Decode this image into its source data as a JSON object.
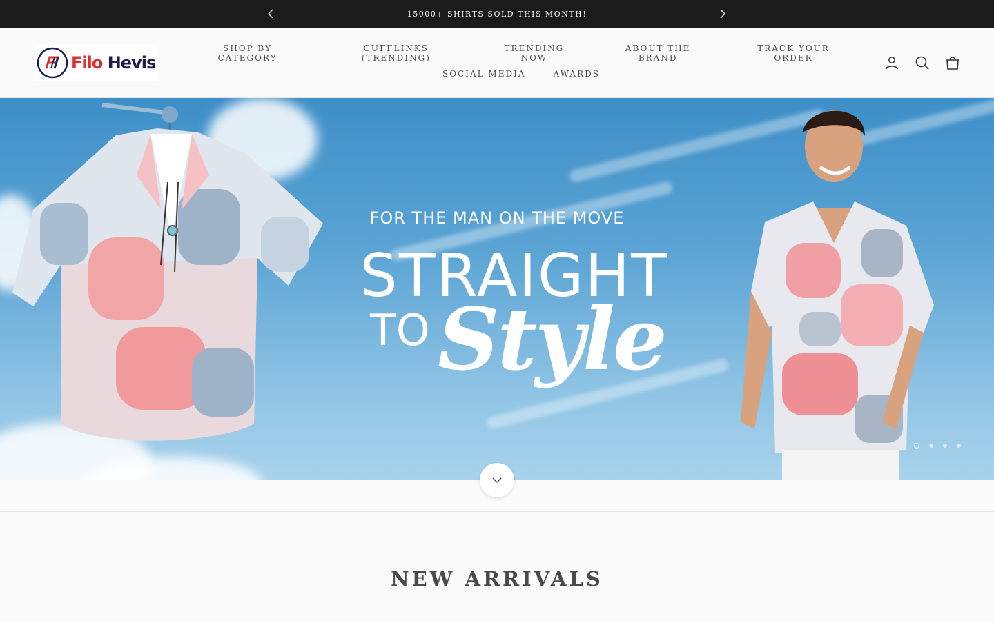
{
  "announcement": {
    "message": "15000+ SHIRTS SOLD THIS MONTH!",
    "prev_icon": "chevron-left-icon",
    "next_icon": "chevron-right-icon"
  },
  "header": {
    "logo": {
      "filo": "Filo",
      "hevis": "Hevis",
      "brand_colors": {
        "red": "#e32b2b",
        "navy": "#1c1d4e"
      }
    },
    "nav_row1": [
      "SHOP BY CATEGORY",
      "CUFFLINKS (TRENDING)",
      "TRENDING NOW",
      "ABOUT THE BRAND",
      "TRACK YOUR ORDER"
    ],
    "nav_row2": [
      "SOCIAL MEDIA",
      "AWARDS"
    ],
    "icons": [
      "account-icon",
      "search-icon",
      "cart-icon"
    ]
  },
  "hero": {
    "tagline": "FOR THE MAN ON THE MOVE",
    "headline_line1": "STRAIGHT",
    "headline_to": "TO",
    "headline_style": "Style",
    "slide_count": 4,
    "active_slide": 1,
    "scroll_icon": "chevron-down-icon"
  },
  "sections": {
    "new_arrivals_title": "NEW ARRIVALS"
  }
}
